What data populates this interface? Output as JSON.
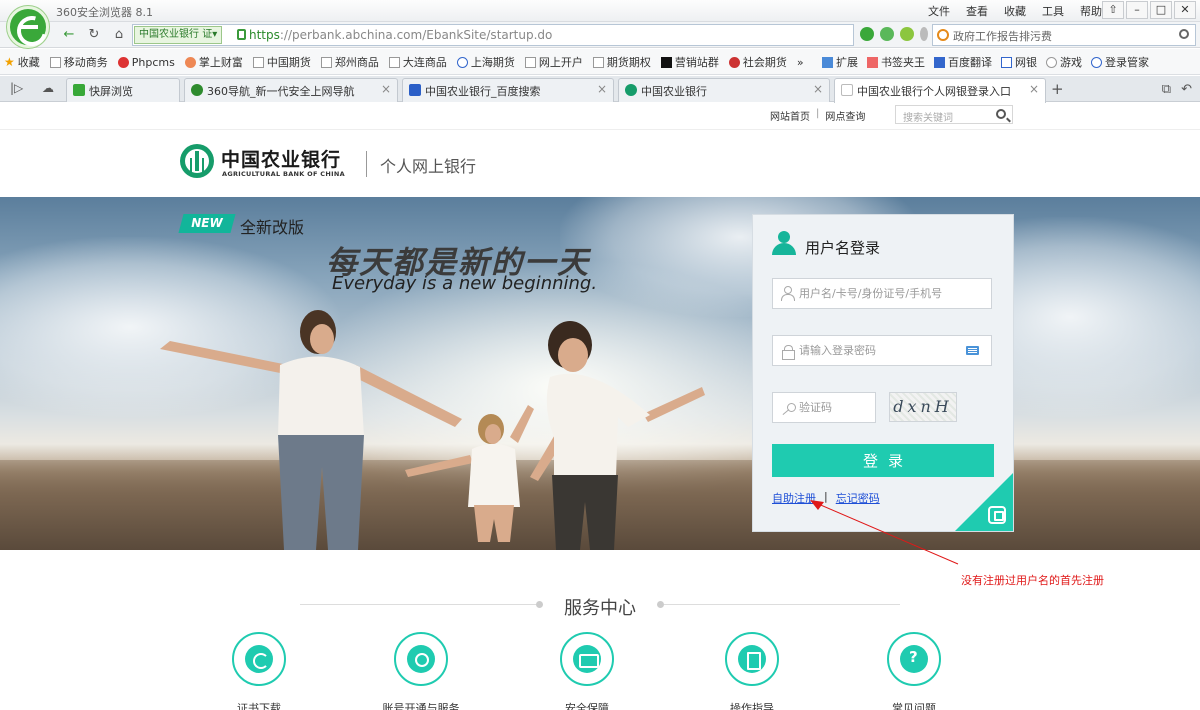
{
  "browser": {
    "window_title": "360安全浏览器 8.1",
    "menu": [
      "文件",
      "查看",
      "收藏",
      "工具",
      "帮助"
    ],
    "url_cert_label": "中国农业银行",
    "url_cert_badge": "证",
    "url_prefix": "https",
    "url_rest": "://perbank.abchina.com/EbankSite/startup.do",
    "search_text": "政府工作报告排污费",
    "bookmarks": [
      "收藏",
      "移动商务",
      "Phpcms",
      "掌上财富",
      "中国期货",
      "郑州商品",
      "大连商品",
      "上海期货",
      "网上开户",
      "期货期权",
      "营销站群",
      "社会期货"
    ],
    "bookmark_right": [
      "扩展",
      "书签夹王",
      "百度翻译",
      "网银",
      "游戏",
      "登录管家"
    ],
    "tabs": [
      {
        "label": "快屏浏览",
        "color": "#38a838"
      },
      {
        "label": "360导航_新一代安全上网导航",
        "color": "#2e8b2e"
      },
      {
        "label": "中国农业银行_百度搜索",
        "color": "#2b5fc7"
      },
      {
        "label": "中国农业银行",
        "color": "#169c6a"
      },
      {
        "label": "中国农业银行个人网银登录入口",
        "color": "#cccccc"
      }
    ]
  },
  "header": {
    "links": [
      "网站首页",
      "网点查询"
    ],
    "search_placeholder": "搜索关键词",
    "bank_name_cn": "中国农业银行",
    "bank_name_en": "AGRICULTURAL BANK OF CHINA",
    "ebank_title": "个人网上银行"
  },
  "hero": {
    "badge": "NEW",
    "badge_label": "全新改版",
    "slogan_cn": "每天都是新的一天",
    "slogan_en": "Everyday is a new beginning."
  },
  "login": {
    "title": "用户名登录",
    "username_placeholder": "用户名/卡号/身份证号/手机号",
    "password_placeholder": "请输入登录密码",
    "captcha_placeholder": "验证码",
    "captcha_text": "dxnH",
    "submit_label": "登录",
    "register_link": "自助注册",
    "forgot_link": "忘记密码"
  },
  "annotation": {
    "text": "没有注册过用户名的首先注册"
  },
  "service": {
    "title": "服务中心",
    "items": [
      {
        "label": "证书下载"
      },
      {
        "label": "账号开通与服务"
      },
      {
        "label": "安全保障"
      },
      {
        "label": "操作指导"
      },
      {
        "label": "常见问题"
      }
    ]
  },
  "colors": {
    "brand_green": "#169c6a",
    "accent_teal": "#1fcbb0",
    "annotation_red": "#e01818",
    "link_blue": "#1e4fd6"
  }
}
